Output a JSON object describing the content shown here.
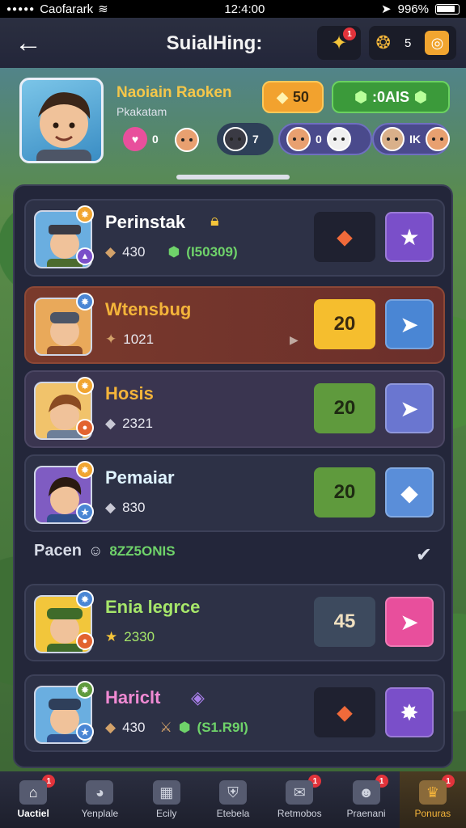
{
  "status_bar": {
    "carrier": "Caofarark",
    "time": "12:4:00",
    "battery": "996%"
  },
  "header": {
    "title": "SuialHing:",
    "back_icon": "arrow-left-icon",
    "notification_badge": "1",
    "coins": "5"
  },
  "profile": {
    "name": "Naoiain Raoken",
    "subtitle": "Pkakatam",
    "gold": "50",
    "gems": ":0AIS",
    "chips": [
      {
        "icon": "heart-icon",
        "value": "0"
      },
      {
        "icon": "ninja-icon",
        "value": "7"
      },
      {
        "icon": "face-icon",
        "value": "0"
      },
      {
        "icon": "face-icon",
        "value": "IK"
      }
    ]
  },
  "players": [
    {
      "name": "Perinstak",
      "name_color": "#ffffff",
      "stat": "430",
      "gems": "(I50309)",
      "action_value": "",
      "action_color": "#1f2130",
      "button_color": "#7a4fc9",
      "button_icon": "★",
      "avatar_bg": "#6aaee0"
    },
    {
      "name": "Wtensbug",
      "name_color": "#f4b43a",
      "stat": "1021",
      "gems": "",
      "action_value": "20",
      "action_color": "#f5be2e",
      "button_color": "#4a86d4",
      "button_icon": "➤",
      "avatar_bg": "#e9a95a"
    },
    {
      "name": "Hosis",
      "name_color": "#f4b43a",
      "stat": "2321",
      "gems": "",
      "action_value": "20",
      "action_color": "#5f9a3d",
      "button_color": "#6a76d0",
      "button_icon": "➤",
      "avatar_bg": "#f1c36b"
    },
    {
      "name": "Pemaiar",
      "name_color": "#dff3ff",
      "stat": "830",
      "gems": "",
      "action_value": "20",
      "action_color": "#5f9a3d",
      "button_color": "#5a8ed9",
      "button_icon": "◆",
      "avatar_bg": "#7f5cc2"
    }
  ],
  "section": {
    "label": "Pacen",
    "count": "8ZZ5ONIS"
  },
  "players_more": [
    {
      "name": "Enia legrce",
      "name_color": "#a6e66a",
      "stat": "2330",
      "gems": "",
      "action_value": "45",
      "action_color": "#3d4a5e",
      "button_color": "#e84f9c",
      "button_icon": "➤",
      "avatar_bg": "#f2c63b"
    },
    {
      "name": "Hariclt",
      "name_color": "#f08ad3",
      "stat": "430",
      "gems": "(S1.R9I)",
      "action_value": "",
      "action_color": "#1f2130",
      "button_color": "#7a4fc9",
      "button_icon": "✸",
      "avatar_bg": "#6aaee0"
    }
  ],
  "nav": [
    {
      "label": "Uactiel",
      "badge": "1",
      "icon": "home-icon"
    },
    {
      "label": "Yenplale",
      "badge": "",
      "icon": "palette-icon"
    },
    {
      "label": "Ecily",
      "badge": "",
      "icon": "box-icon"
    },
    {
      "label": "Etebela",
      "badge": "",
      "icon": "shield-icon"
    },
    {
      "label": "Retmobos",
      "badge": "1",
      "icon": "chat-icon"
    },
    {
      "label": "Praenani",
      "badge": "1",
      "icon": "person-icon"
    },
    {
      "label": "Ponuras",
      "badge": "1",
      "icon": "trophy-icon"
    }
  ]
}
